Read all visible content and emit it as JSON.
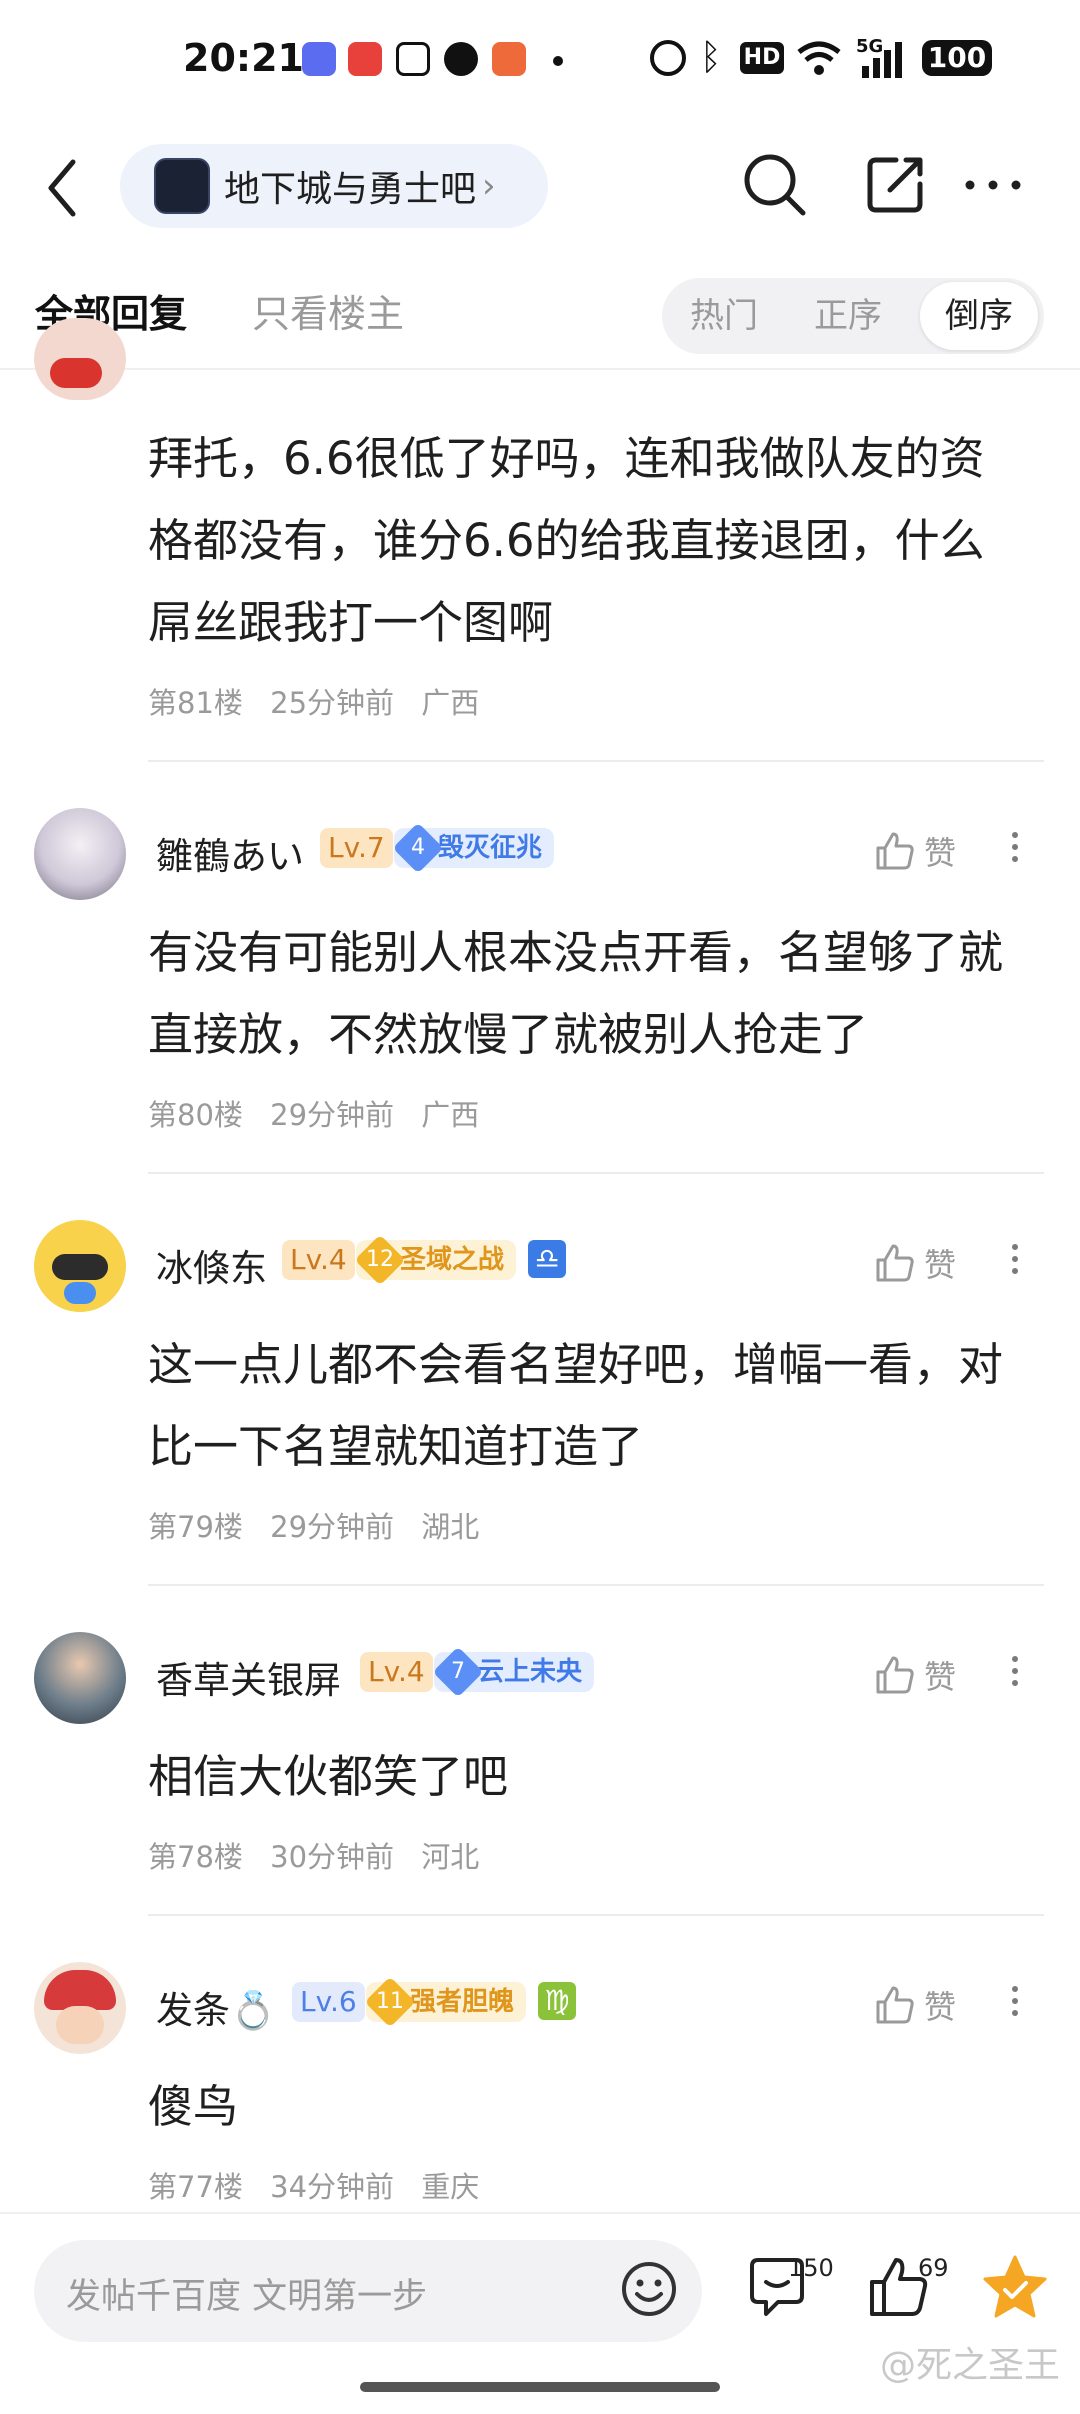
{
  "status_bar": {
    "time": "20:21",
    "app_icons": [
      "tieba-icon",
      "redbook-icon",
      "bilibili-icon",
      "wechat-icon",
      "game-icon"
    ],
    "network": "5G",
    "hd": "HD",
    "battery": "100"
  },
  "nav": {
    "forum_name": "地下城与勇士吧",
    "chevron": "›"
  },
  "tabs": {
    "all_replies": "全部回复",
    "only_op": "只看楼主",
    "sort": [
      "热门",
      "正序",
      "倒序"
    ],
    "active_sort": "倒序"
  },
  "top_post": {
    "text_lines": [
      "拜托，6.6很低了好吗，连和我做队友的资",
      "格都没有，谁分6.6的给我直接退团，什么",
      "屌丝跟我打一个图啊"
    ],
    "floor": "第81楼",
    "time": "25分钟前",
    "location": "广西"
  },
  "posts": [
    {
      "username": "雛鶴あい",
      "level": "Lv.7",
      "badge_num": "4",
      "badge_title": "毁灭征兆",
      "badge_style": "blue",
      "zodiac": "",
      "text_lines": [
        "有没有可能别人根本没点开看，名望够了就",
        "直接放，不然放慢了就被别人抢走了"
      ],
      "floor": "第80楼",
      "time": "29分钟前",
      "location": "广西",
      "like_label": "赞"
    },
    {
      "username": "冰倏东",
      "level": "Lv.4",
      "badge_num": "12",
      "badge_title": "圣域之战",
      "badge_style": "gold",
      "zodiac": "♎",
      "text_lines": [
        "这一点儿都不会看名望好吧，增幅一看，对",
        "比一下名望就知道打造了"
      ],
      "floor": "第79楼",
      "time": "29分钟前",
      "location": "湖北",
      "like_label": "赞"
    },
    {
      "username": "香草关银屏",
      "level": "Lv.4",
      "badge_num": "7",
      "badge_title": "云上未央",
      "badge_style": "blue",
      "zodiac": "",
      "text_lines": [
        "相信大伙都笑了吧"
      ],
      "floor": "第78楼",
      "time": "30分钟前",
      "location": "河北",
      "like_label": "赞"
    },
    {
      "username": "发条💍",
      "level": "Lv.6",
      "badge_num": "11",
      "badge_title": "强者胆魄",
      "badge_style": "gold",
      "zodiac": "♍",
      "text_lines": [
        "傻鸟"
      ],
      "floor": "第77楼",
      "time": "34分钟前",
      "location": "重庆",
      "like_label": "赞"
    }
  ],
  "bottom_bar": {
    "compose_placeholder": "发帖千百度 文明第一步",
    "comment_count": "150",
    "like_count": "69"
  },
  "watermark": "@死之圣王"
}
